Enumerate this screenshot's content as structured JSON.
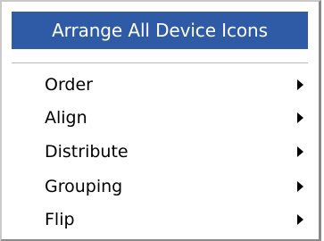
{
  "menu": {
    "header_label": "Arrange All Device Icons",
    "items": [
      {
        "label": "Order",
        "icon": "chevron-right-icon"
      },
      {
        "label": "Align",
        "icon": "chevron-right-icon"
      },
      {
        "label": "Distribute",
        "icon": "chevron-right-icon"
      },
      {
        "label": "Grouping",
        "icon": "chevron-right-icon"
      },
      {
        "label": "Flip",
        "icon": "chevron-right-icon"
      }
    ]
  },
  "colors": {
    "highlight": "#2f5aa5",
    "highlight_text": "#ffffff",
    "menu_background": "#ffffff",
    "text": "#000000"
  }
}
